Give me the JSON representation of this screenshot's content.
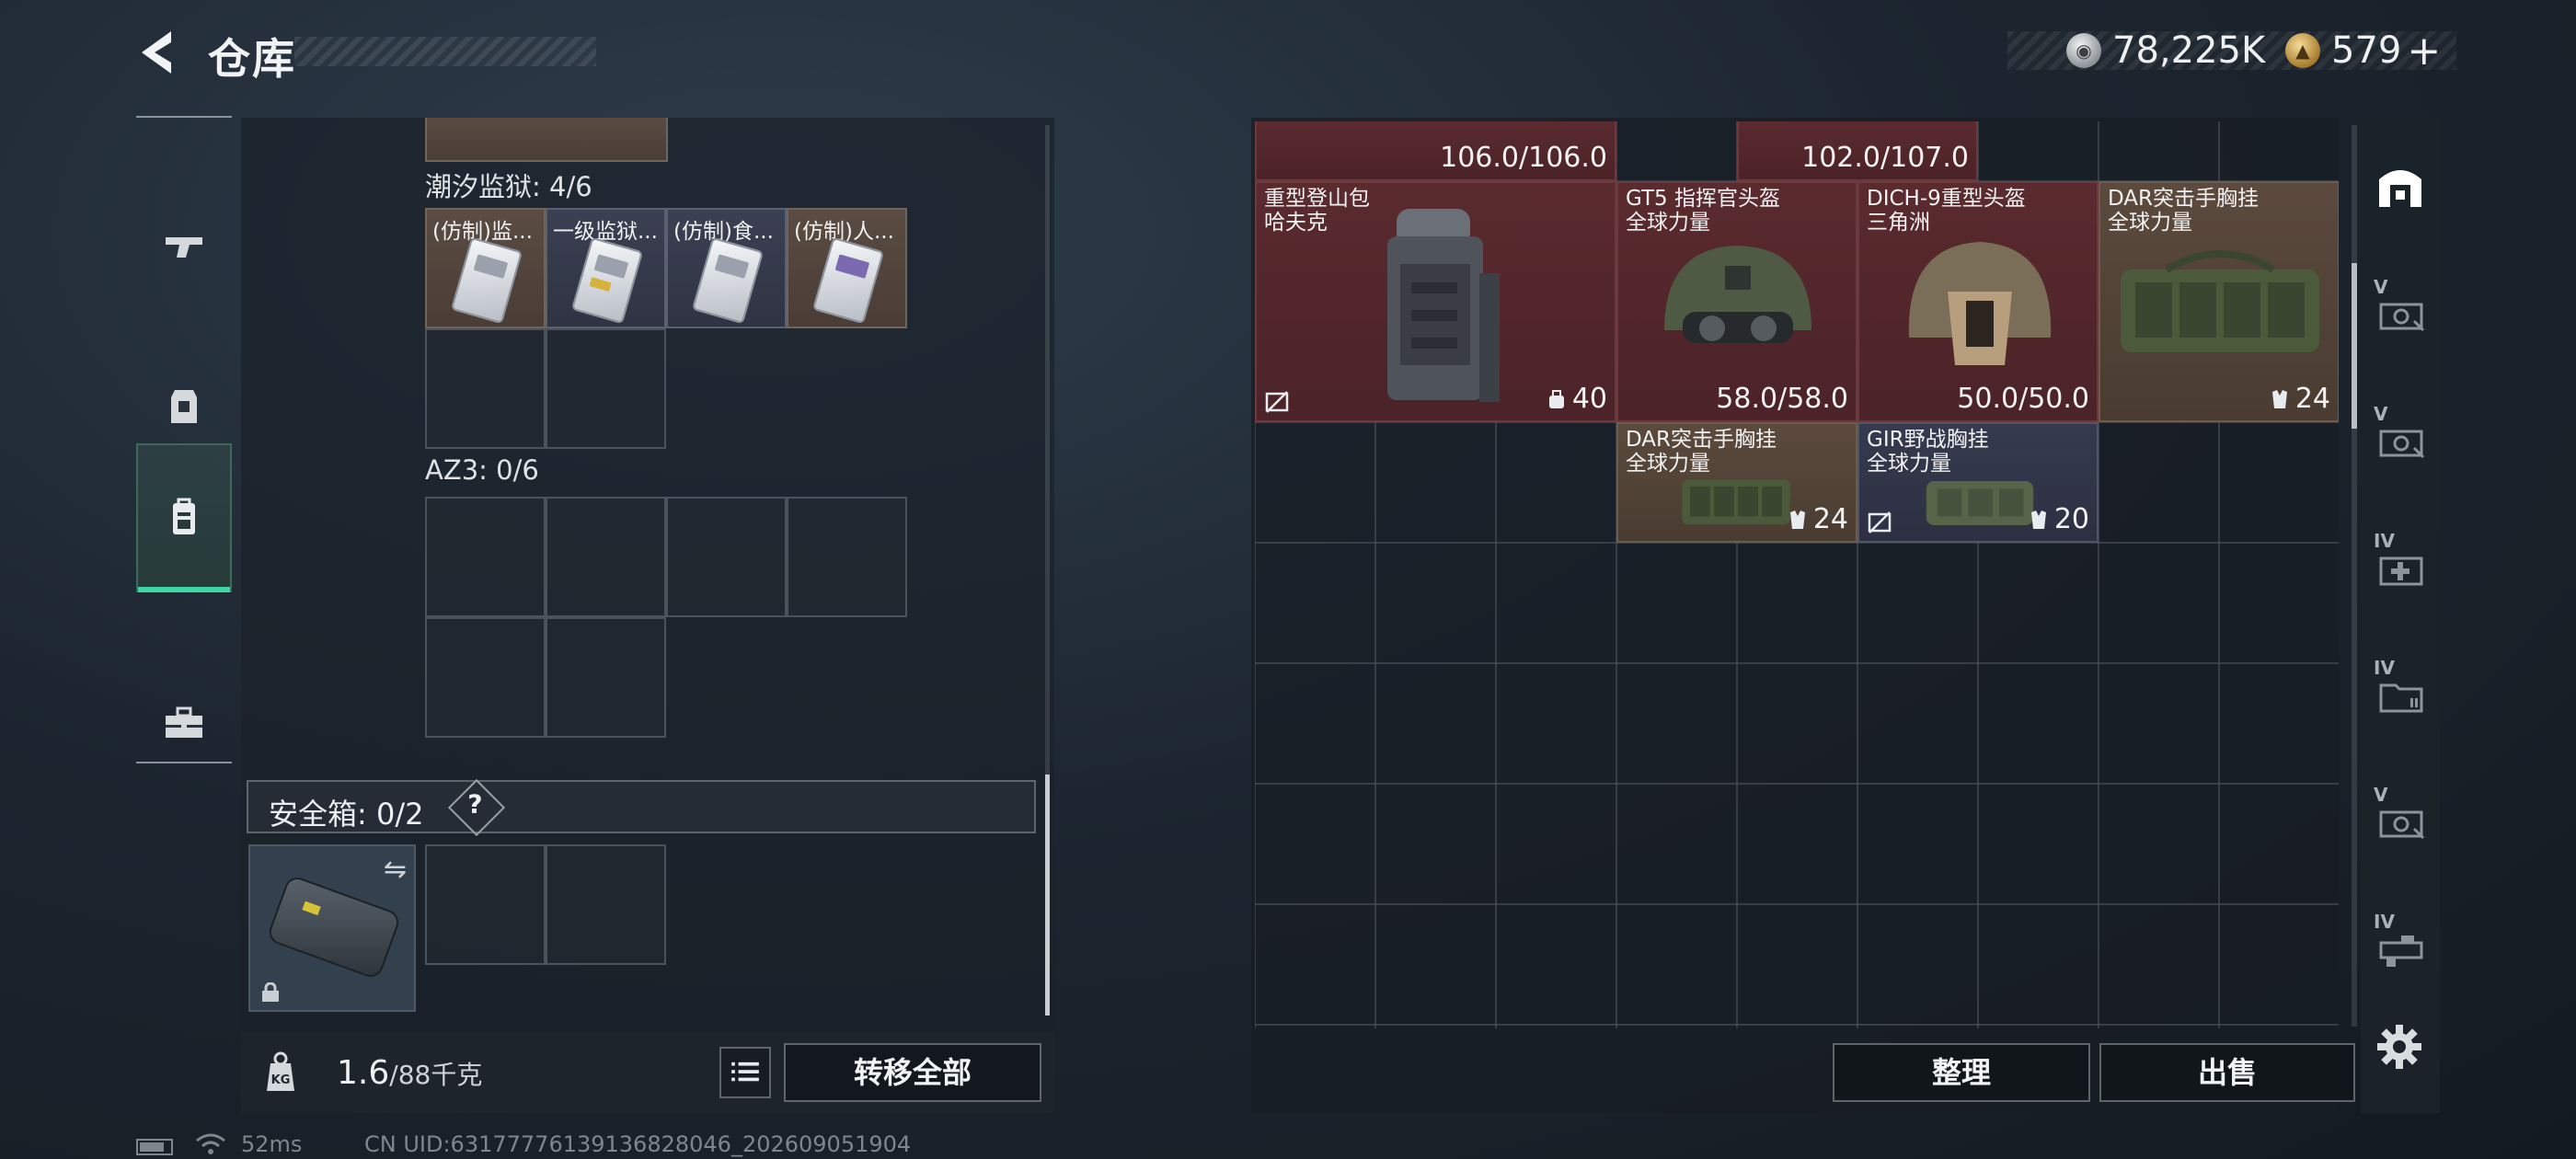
{
  "header": {
    "title": "仓库",
    "currency_silver": "78,225K",
    "currency_gold": "579",
    "plus": "+"
  },
  "left_nav": {
    "items": [
      {
        "icon": "pistol-icon"
      },
      {
        "icon": "armor-vest-icon"
      },
      {
        "icon": "backpack-icon",
        "active": true
      },
      {
        "icon": "toolbox-icon"
      }
    ]
  },
  "containers": {
    "tide_prison": {
      "label": "潮汐监狱: 4/6",
      "items": [
        "(仿制)监...",
        "一级监狱...",
        "(仿制)食...",
        "(仿制)人..."
      ]
    },
    "az3": {
      "label": "AZ3: 0/6"
    },
    "safe_box": {
      "label": "安全箱: 0/2",
      "help": "?"
    }
  },
  "weight": {
    "current": "1.6",
    "max": "/88千克",
    "kg_badge": "KG"
  },
  "buttons": {
    "transfer_all": "转移全部",
    "sort": "整理",
    "sell": "出售"
  },
  "stash": {
    "top_values": [
      "106.0/106.0",
      "102.0/107.0"
    ],
    "items": [
      {
        "name": "重型登山包",
        "brand": "哈夫克",
        "value": "40",
        "rarity": "red"
      },
      {
        "name": "GT5 指挥官头盔",
        "brand": "全球力量",
        "value": "58.0/58.0",
        "rarity": "red"
      },
      {
        "name": "DICH-9重型头盔",
        "brand": "三角洲",
        "value": "50.0/50.0",
        "rarity": "red"
      },
      {
        "name": "DAR突击手胸挂",
        "brand": "全球力量",
        "value": "24",
        "rarity": "brown"
      },
      {
        "name": "DAR突击手胸挂",
        "brand": "全球力量",
        "value": "24",
        "rarity": "brown"
      },
      {
        "name": "GIR野战胸挂",
        "brand": "全球力量",
        "value": "20",
        "rarity": "navy"
      }
    ]
  },
  "right_sidebar": {
    "items": [
      {
        "icon": "stash-home-icon",
        "tier": ""
      },
      {
        "icon": "stash-v-case-icon",
        "tier": "V"
      },
      {
        "icon": "stash-v-case-icon",
        "tier": "V"
      },
      {
        "icon": "stash-iv-medical-icon",
        "tier": "IV"
      },
      {
        "icon": "stash-iv-folder-icon",
        "tier": "IV"
      },
      {
        "icon": "stash-v-case-icon",
        "tier": "V"
      },
      {
        "icon": "stash-iv-weapon-icon",
        "tier": "IV"
      }
    ]
  },
  "status_bar": {
    "ping": "52ms",
    "uid": "CN UID:6317777613913682​8046_202609051904"
  },
  "colors": {
    "accent_green": "#3ed7a4",
    "rarity_red": "#5a2a2e",
    "rarity_brown": "#5b4a3d",
    "rarity_navy": "#363a4e"
  }
}
